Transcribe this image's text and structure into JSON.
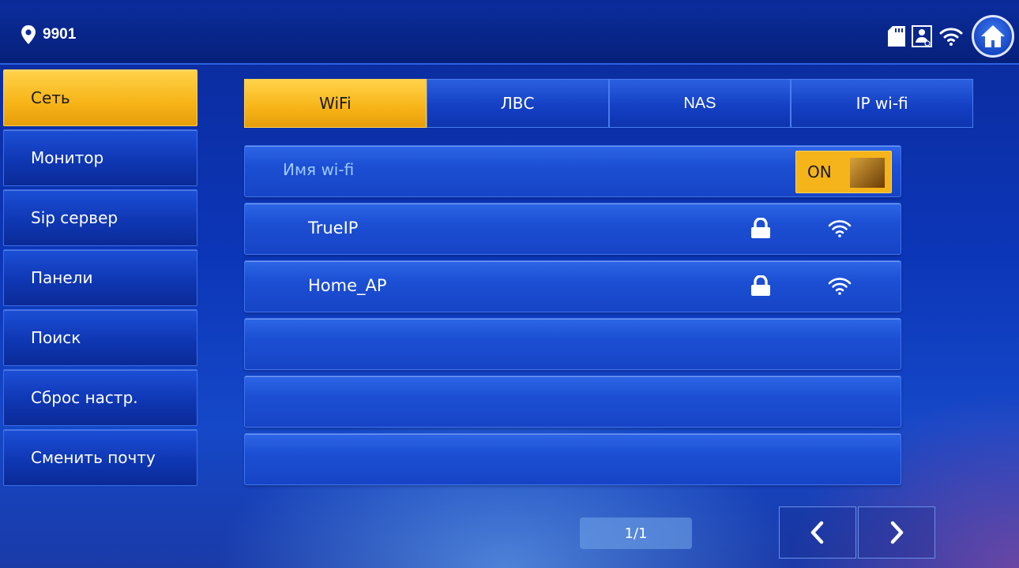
{
  "header": {
    "location_number": "9901",
    "icons": [
      "location-pin-icon",
      "sd-card-icon",
      "contacts-icon",
      "wifi-icon",
      "home-icon"
    ]
  },
  "sidebar": {
    "items": [
      {
        "label": "Сеть",
        "active": true
      },
      {
        "label": "Монитор",
        "active": false
      },
      {
        "label": "Sip сервер",
        "active": false
      },
      {
        "label": "Панели",
        "active": false
      },
      {
        "label": "Поиск",
        "active": false
      },
      {
        "label": "Сброс настр.",
        "active": false
      },
      {
        "label": "Сменить почту",
        "active": false
      }
    ]
  },
  "tabs": [
    {
      "label": "WiFi",
      "active": true
    },
    {
      "label": "ЛВС",
      "active": false
    },
    {
      "label": "NAS",
      "active": false
    },
    {
      "label": "IP wi-fi",
      "active": false
    }
  ],
  "wifi_panel": {
    "header_label": "Имя wi-fi",
    "toggle_label": "ON",
    "networks": [
      {
        "name": "TrueIP",
        "secured": true,
        "signal_icon": "wifi-signal-icon"
      },
      {
        "name": "Home_AP",
        "secured": true,
        "signal_icon": "wifi-signal-icon"
      }
    ]
  },
  "pagination": {
    "page_indicator": "1/1"
  },
  "colors": {
    "accent": "#f7b417",
    "background": "#0c36b8",
    "label_blue": "#9cc8ff"
  }
}
